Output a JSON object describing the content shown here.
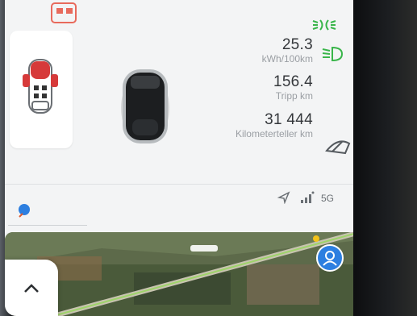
{
  "vehicle_status": {
    "consumption_value": "25.3",
    "consumption_unit": "kWh/100km",
    "trip_value": "156.4",
    "trip_label": "Tripp km",
    "odometer_value": "31 444",
    "odometer_label": "Kilometerteller km"
  },
  "status_bar": {
    "network_label": "5G"
  },
  "colors": {
    "screen_bg": "#f3f4f5",
    "accent_blue": "#2d7fe0",
    "door_red": "#d63a3a",
    "indicator_green": "#39b54a"
  },
  "icons": [
    "door-status-icon",
    "vehicle-top-icon",
    "car-model",
    "parking-lights-icon",
    "low-beam-icon",
    "wiper-icon",
    "bluetooth-icon",
    "location-arrow-icon",
    "signal-icon",
    "profile-icon",
    "chevron-up-icon"
  ]
}
